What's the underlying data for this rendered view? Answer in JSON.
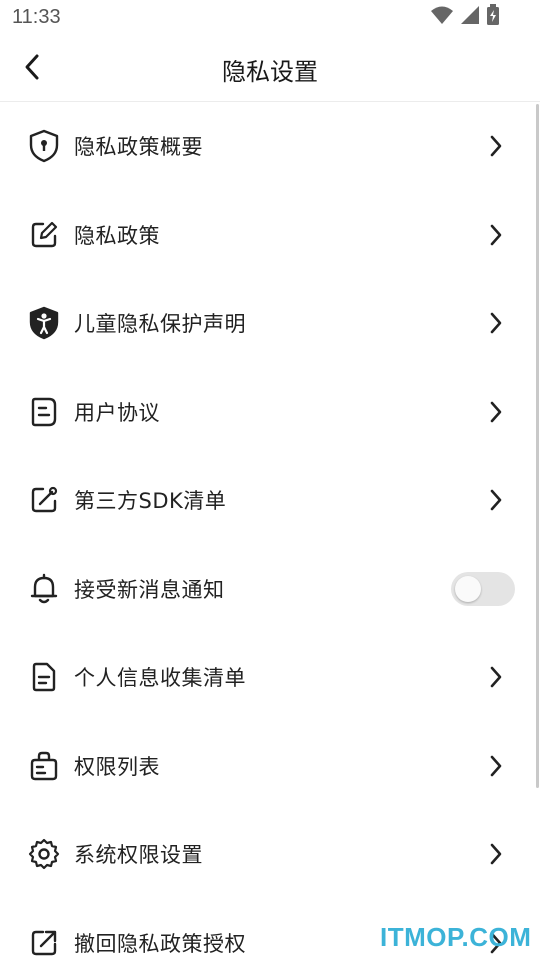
{
  "status_bar": {
    "time": "11:33"
  },
  "header": {
    "title": "隐私设置"
  },
  "menu": {
    "items": [
      {
        "label": "隐私政策概要",
        "icon": "shield-lock-icon"
      },
      {
        "label": "隐私政策",
        "icon": "edit-note-icon"
      },
      {
        "label": "儿童隐私保护声明",
        "icon": "child-shield-icon"
      },
      {
        "label": "用户协议",
        "icon": "document-icon"
      },
      {
        "label": "第三方SDK清单",
        "icon": "external-link-icon"
      },
      {
        "label": "接受新消息通知",
        "icon": "bell-icon",
        "toggle": false
      },
      {
        "label": "个人信息收集清单",
        "icon": "file-list-icon"
      },
      {
        "label": "权限列表",
        "icon": "bag-list-icon"
      },
      {
        "label": "系统权限设置",
        "icon": "gear-icon"
      },
      {
        "label": "撤回隐私政策授权",
        "icon": "share-out-icon"
      }
    ]
  },
  "watermark": "ITMOP.COM",
  "colors": {
    "watermark": "#3cb3d8",
    "toggle_off": "#e4e4e4",
    "text": "#222222"
  }
}
